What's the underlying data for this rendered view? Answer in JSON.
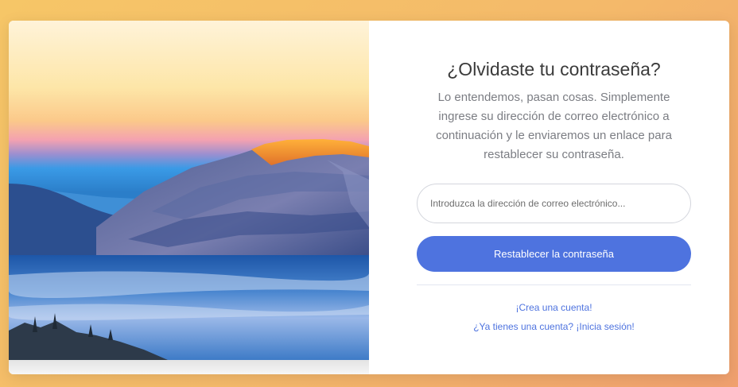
{
  "forgot_password": {
    "title": "¿Olvidaste tu contraseña?",
    "description": "Lo entendemos, pasan cosas. Simplemente ingrese su dirección de correo electrónico a continuación y le enviaremos un enlace para restablecer su contraseña.",
    "email_placeholder": "Introduzca la dirección de correo electrónico...",
    "email_value": "",
    "reset_button_label": "Restablecer la contraseña",
    "create_account_link": "¡Crea una cuenta!",
    "login_link": "¿Ya tienes una cuenta? ¡Inicia sesión!"
  },
  "colors": {
    "primary": "#4e73df",
    "background_start": "#f6c667",
    "background_end": "#f0a06e"
  }
}
